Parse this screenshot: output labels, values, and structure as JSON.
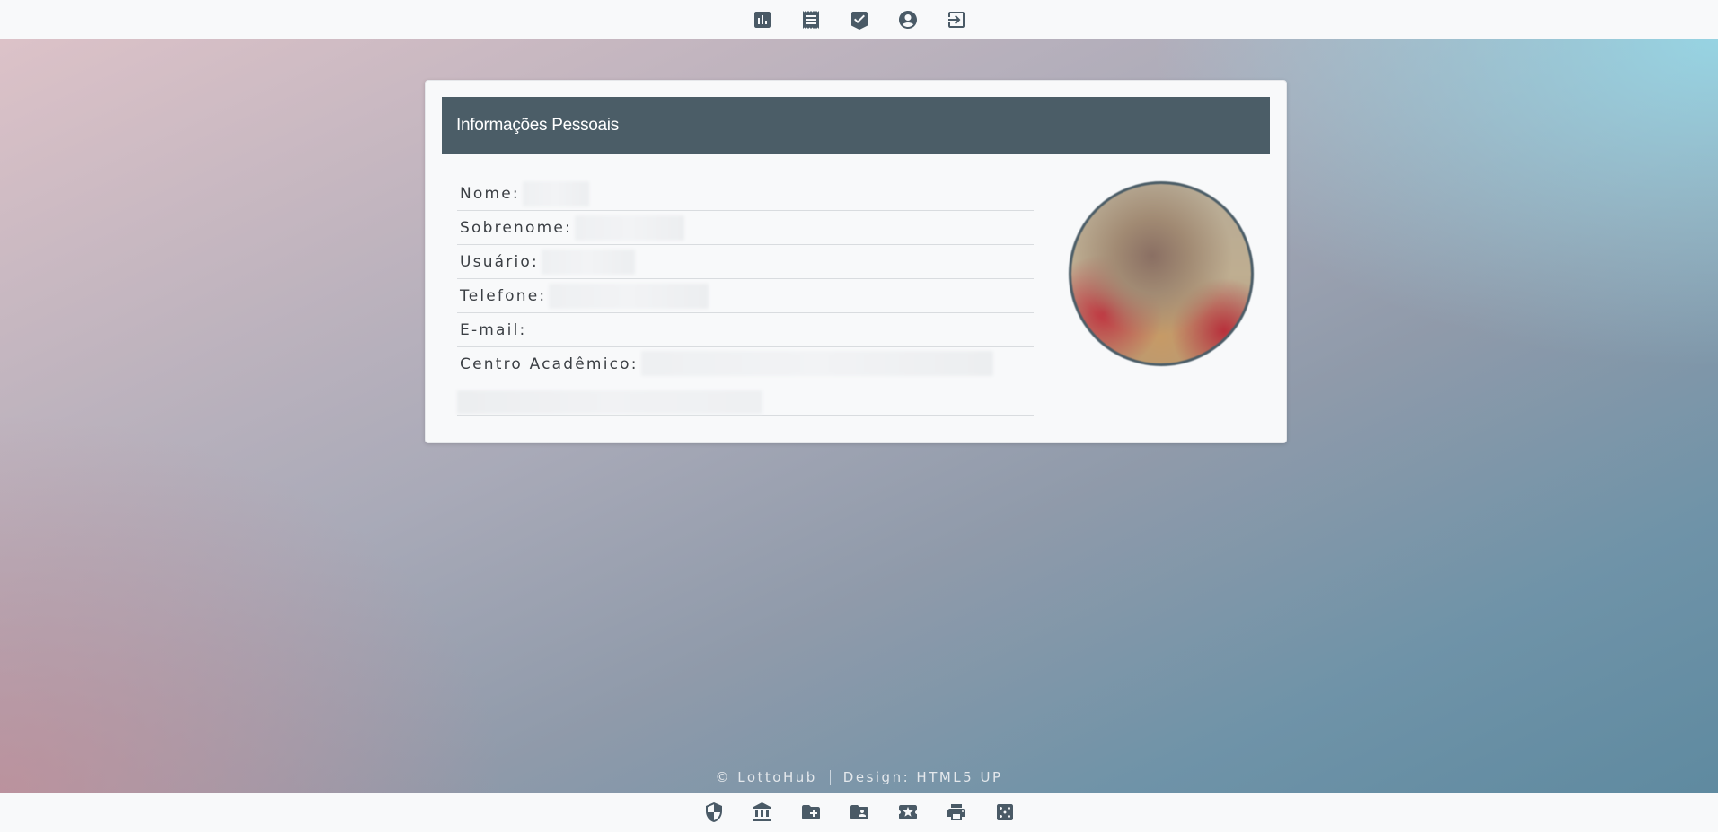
{
  "top_nav": {
    "items": [
      {
        "icon": "bar-chart-icon"
      },
      {
        "icon": "receipt-icon"
      },
      {
        "icon": "verified-check-icon"
      },
      {
        "icon": "account-circle-icon"
      },
      {
        "icon": "logout-icon"
      }
    ]
  },
  "card": {
    "title": "Informações Pessoais",
    "fields": [
      {
        "label": "Nome:"
      },
      {
        "label": "Sobrenome:"
      },
      {
        "label": "Usuário:"
      },
      {
        "label": "Telefone:"
      },
      {
        "label": "E-mail:"
      },
      {
        "label": "Centro Acadêmico:"
      }
    ],
    "avatar_icon": "profile-photo"
  },
  "footer": {
    "copyright": "© LottoHub",
    "design": "Design: HTML5 UP"
  },
  "bottom_nav": {
    "items": [
      {
        "icon": "shield-icon"
      },
      {
        "icon": "bank-icon"
      },
      {
        "icon": "folder-add-icon"
      },
      {
        "icon": "folder-user-icon"
      },
      {
        "icon": "ticket-star-icon"
      },
      {
        "icon": "printer-icon"
      },
      {
        "icon": "dice-icon"
      }
    ]
  },
  "colors": {
    "header_bg": "#4b5d67",
    "icon": "#4a5a66",
    "card_bg": "#f8f9fa"
  }
}
